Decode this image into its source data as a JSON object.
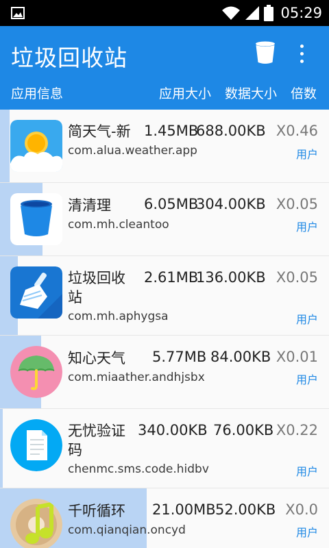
{
  "status": {
    "time": "05:29"
  },
  "header": {
    "title": "垃圾回收站",
    "col_info": "应用信息",
    "col_app_size": "应用大小",
    "col_data_size": "数据大小",
    "col_ratio": "倍数"
  },
  "apps": [
    {
      "name": "简天气-新",
      "package": "com.alua.weather.app",
      "app_size": "1.45MB",
      "data_size": "688.00KB",
      "ratio": "X0.46",
      "tag": "用户",
      "bar_fraction": 0.03,
      "icon": "weather-sun-cloud-icon"
    },
    {
      "name": "清清理",
      "package": "com.mh.cleantoo",
      "app_size": "6.05MB",
      "data_size": "304.00KB",
      "ratio": "X0.05",
      "tag": "用户",
      "bar_fraction": 0.13,
      "icon": "trash-bin-icon"
    },
    {
      "name": "垃圾回收站",
      "package": "com.mh.aphygsa",
      "app_size": "2.61MB",
      "data_size": "136.00KB",
      "ratio": "X0.05",
      "tag": "用户",
      "bar_fraction": 0.055,
      "icon": "broom-icon"
    },
    {
      "name": "知心天气",
      "package": "com.miaather.andhjsbx",
      "app_size": "5.77MB",
      "data_size": "84.00KB",
      "ratio": "X0.01",
      "tag": "用户",
      "bar_fraction": 0.125,
      "icon": "umbrella-icon"
    },
    {
      "name": "无忧验证码",
      "package": "chenmc.sms.code.hidbv",
      "app_size": "340.00KB",
      "data_size": "76.00KB",
      "ratio": "X0.22",
      "tag": "用户",
      "bar_fraction": 0.008,
      "icon": "document-icon"
    },
    {
      "name": "千听循环",
      "package": "com.qianqian.oncyd",
      "app_size": "21.00MB",
      "data_size": "52.00KB",
      "ratio": "X0.0",
      "tag": "用户",
      "bar_fraction": 0.45,
      "icon": "music-note-icon"
    }
  ]
}
